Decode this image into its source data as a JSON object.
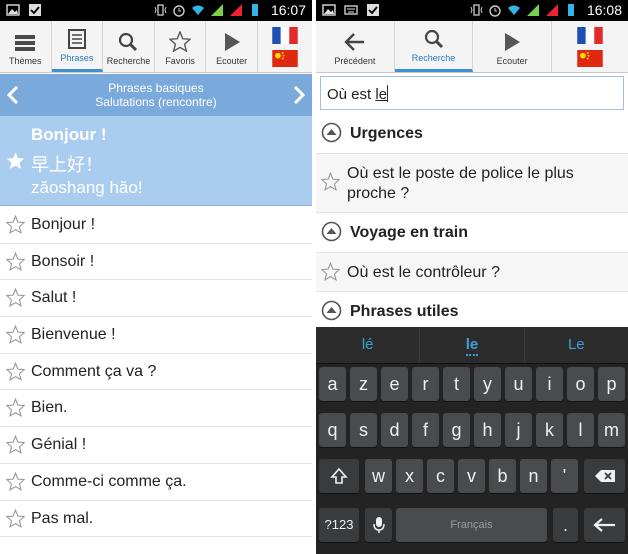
{
  "left": {
    "status": {
      "time": "16:07"
    },
    "toolbar": [
      {
        "label": "Thèmes",
        "icon": "list-icon",
        "active": false
      },
      {
        "label": "Phrases",
        "icon": "document-icon",
        "active": true
      },
      {
        "label": "Recherche",
        "icon": "search-icon",
        "active": false
      },
      {
        "label": "Favoris",
        "icon": "star-icon",
        "active": false
      },
      {
        "label": "Ecouter",
        "icon": "play-icon",
        "active": false
      }
    ],
    "subnav": {
      "line1": "Phrases basiques",
      "line2": "Salutations (rencontre)"
    },
    "featured": {
      "french": "Bonjour !",
      "chinese": "早上好！",
      "pinyin": "zăoshang hăo!"
    },
    "phrases": [
      "Bonjour !",
      "Bonsoir !",
      "Salut !",
      "Bienvenue !",
      "Comment ça va ?",
      "Bien.",
      "Génial !",
      "Comme-ci comme ça.",
      "Pas mal."
    ]
  },
  "right": {
    "status": {
      "time": "16:08"
    },
    "toolbar": [
      {
        "label": "Précédent",
        "icon": "back-arrow-icon",
        "active": false
      },
      {
        "label": "Recherche",
        "icon": "search-icon",
        "active": true
      },
      {
        "label": "Ecouter",
        "icon": "play-icon",
        "active": false
      }
    ],
    "search": {
      "prefix": "Où est ",
      "underlined": "le"
    },
    "results": [
      {
        "kind": "section",
        "title": "Urgences"
      },
      {
        "kind": "item",
        "text": "Où est le poste de police le plus proche ?"
      },
      {
        "kind": "section",
        "title": "Voyage en train"
      },
      {
        "kind": "item",
        "text": "Où est le contrôleur ?"
      },
      {
        "kind": "section",
        "title": "Phrases utiles"
      }
    ],
    "keyboard": {
      "suggestions": [
        "lé",
        "le",
        "Le"
      ],
      "row1": [
        "a",
        "z",
        "e",
        "r",
        "t",
        "y",
        "u",
        "i",
        "o",
        "p"
      ],
      "row2": [
        "q",
        "s",
        "d",
        "f",
        "g",
        "h",
        "j",
        "k",
        "l",
        "m"
      ],
      "row3": [
        "w",
        "x",
        "c",
        "v",
        "b",
        "n",
        "'"
      ],
      "numbers_key": "?123",
      "space_label": "Français",
      "period_key": "."
    }
  },
  "colors": {
    "accent": "#3d8fd0",
    "subnav": "#7aa9dc",
    "selected_row": "#aaccef",
    "suggestion": "#3aa1d8"
  }
}
